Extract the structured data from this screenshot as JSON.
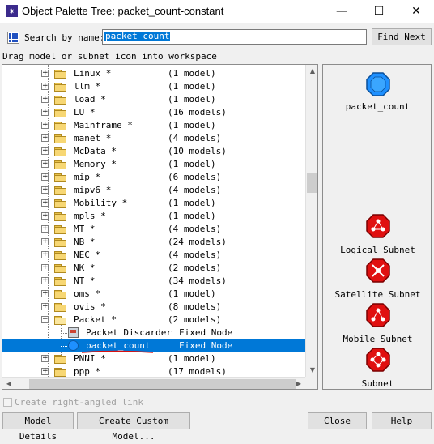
{
  "window": {
    "title": "Object Palette Tree: packet_count-constant",
    "minimize_label": "—",
    "maximize_label": "☐",
    "close_label": "✕"
  },
  "search": {
    "label": "Search by name:",
    "value": "packet_count",
    "find_next_label": "Find Next"
  },
  "hint": "Drag model or subnet icon into workspace",
  "tree": {
    "rows": [
      {
        "name": "Linux *",
        "count": "(1 model)"
      },
      {
        "name": "llm *",
        "count": "(1 model)"
      },
      {
        "name": "load *",
        "count": "(1 model)"
      },
      {
        "name": "LU *",
        "count": "(16 models)"
      },
      {
        "name": "Mainframe *",
        "count": "(1 model)"
      },
      {
        "name": "manet *",
        "count": "(4 models)"
      },
      {
        "name": "McData *",
        "count": "(10 models)"
      },
      {
        "name": "Memory *",
        "count": "(1 model)"
      },
      {
        "name": "mip *",
        "count": "(6 models)"
      },
      {
        "name": "mipv6 *",
        "count": "(4 models)"
      },
      {
        "name": "Mobility *",
        "count": "(1 model)"
      },
      {
        "name": "mpls *",
        "count": "(1 model)"
      },
      {
        "name": "MT *",
        "count": "(4 models)"
      },
      {
        "name": "NB *",
        "count": "(24 models)"
      },
      {
        "name": "NEC *",
        "count": "(4 models)"
      },
      {
        "name": "NK *",
        "count": "(2 models)"
      },
      {
        "name": "NT *",
        "count": "(34 models)"
      },
      {
        "name": "oms *",
        "count": "(1 model)"
      },
      {
        "name": "ovis *",
        "count": "(8 models)"
      },
      {
        "name": "Packet *",
        "count": "(2 models)"
      },
      {
        "name": "Packet Discarder",
        "count": "Fixed Node"
      },
      {
        "name": "packet_count",
        "count": "Fixed Node"
      },
      {
        "name": "PNNI *",
        "count": "(1 model)"
      },
      {
        "name": "ppp *",
        "count": "(17 models)"
      }
    ]
  },
  "palette": {
    "items": [
      {
        "label": "packet_count",
        "color": "#1e90ff"
      },
      {
        "label": "Logical Subnet",
        "color": "#e01010"
      },
      {
        "label": "Satellite Subnet",
        "color": "#e01010"
      },
      {
        "label": "Mobile Subnet",
        "color": "#e01010"
      },
      {
        "label": "Subnet",
        "color": "#e01010"
      }
    ]
  },
  "options": {
    "right_angled_label": "Create right-angled link"
  },
  "buttons": {
    "model_details": "Model Details",
    "create_custom_model": "Create Custom Model...",
    "close": "Close",
    "help": "Help"
  }
}
